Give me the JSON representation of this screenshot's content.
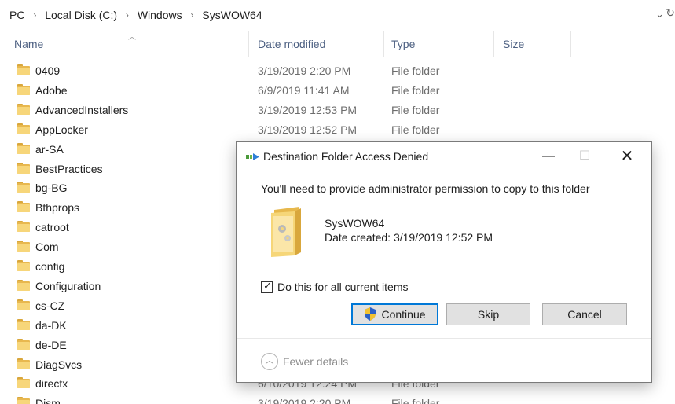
{
  "breadcrumb": {
    "items": [
      "PC",
      "Local Disk (C:)",
      "Windows",
      "SysWOW64"
    ],
    "separator": "›"
  },
  "columns": {
    "name": "Name",
    "date_modified": "Date modified",
    "type": "Type",
    "size": "Size"
  },
  "files": [
    {
      "name": "0409",
      "date": "3/19/2019 2:20 PM",
      "type": "File folder"
    },
    {
      "name": "Adobe",
      "date": "6/9/2019 11:41 AM",
      "type": "File folder"
    },
    {
      "name": "AdvancedInstallers",
      "date": "3/19/2019 12:53 PM",
      "type": "File folder"
    },
    {
      "name": "AppLocker",
      "date": "3/19/2019 12:52 PM",
      "type": "File folder"
    },
    {
      "name": "ar-SA",
      "date": "",
      "type": ""
    },
    {
      "name": "BestPractices",
      "date": "",
      "type": ""
    },
    {
      "name": "bg-BG",
      "date": "",
      "type": ""
    },
    {
      "name": "Bthprops",
      "date": "",
      "type": ""
    },
    {
      "name": "catroot",
      "date": "",
      "type": ""
    },
    {
      "name": "Com",
      "date": "",
      "type": ""
    },
    {
      "name": "config",
      "date": "",
      "type": ""
    },
    {
      "name": "Configuration",
      "date": "",
      "type": ""
    },
    {
      "name": "cs-CZ",
      "date": "",
      "type": ""
    },
    {
      "name": "da-DK",
      "date": "",
      "type": ""
    },
    {
      "name": "de-DE",
      "date": "",
      "type": ""
    },
    {
      "name": "DiagSvcs",
      "date": "",
      "type": ""
    },
    {
      "name": "directx",
      "date": "6/10/2019 12:24 PM",
      "type": "File folder"
    },
    {
      "name": "Dism",
      "date": "3/19/2019 2:20 PM",
      "type": "File folder"
    }
  ],
  "dialog": {
    "title": "Destination Folder Access Denied",
    "minimize_glyph": "—",
    "maximize_glyph": "☐",
    "close_glyph": "✕",
    "message": "You'll need to provide administrator permission to copy to this folder",
    "folder_name": "SysWOW64",
    "folder_date": "Date created: 3/19/2019 12:52 PM",
    "checkbox_label": "Do this for all current items",
    "checkbox_checked": true,
    "checkbox_mark": "✓",
    "buttons": {
      "continue": "Continue",
      "skip": "Skip",
      "cancel": "Cancel"
    },
    "details_label": "Fewer details",
    "details_glyph": "︿"
  },
  "colors": {
    "accent": "#0078d7",
    "folder": "#f7d67a",
    "header_text": "#4d6082",
    "secondary_text": "#6d6d6d"
  },
  "icons": {
    "folder": "folder-icon",
    "shield": "uac-shield-icon",
    "title": "copy-transfer-icon"
  }
}
